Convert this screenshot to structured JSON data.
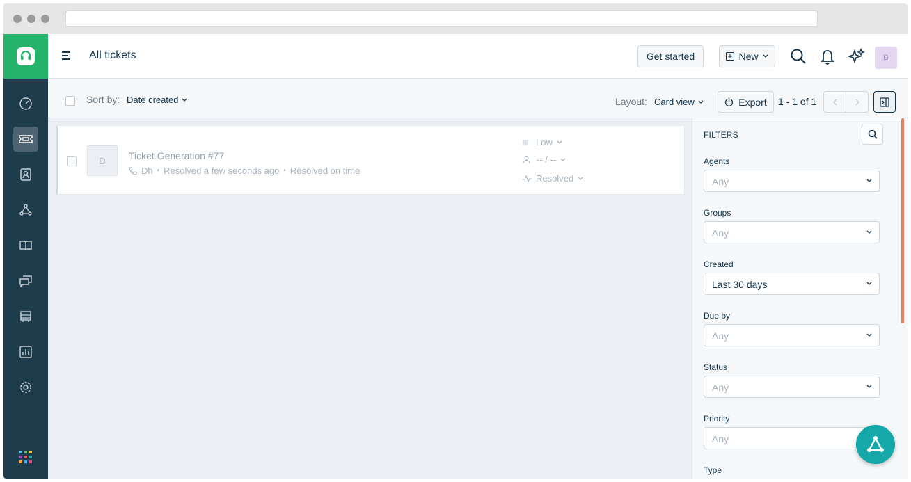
{
  "header": {
    "title": "All tickets",
    "get_started": "Get started",
    "new_label": "New",
    "avatar_initial": "D"
  },
  "toolbar": {
    "sort_label": "Sort by:",
    "sort_value": "Date created",
    "layout_label": "Layout:",
    "layout_value": "Card view",
    "export_label": "Export",
    "pagination": "1 - 1 of 1"
  },
  "ticket": {
    "avatar_initial": "D",
    "title": "Ticket Generation",
    "number": "#77",
    "requester": "Dh",
    "resolved_time": "Resolved a few seconds ago",
    "sla_status": "Resolved on time",
    "priority": "Low",
    "assignee": "-- / --",
    "status": "Resolved"
  },
  "filters": {
    "heading": "FILTERS",
    "items": [
      {
        "label": "Agents",
        "value": "Any"
      },
      {
        "label": "Groups",
        "value": "Any"
      },
      {
        "label": "Created",
        "value": "Last 30 days"
      },
      {
        "label": "Due by",
        "value": "Any"
      },
      {
        "label": "Status",
        "value": "Any"
      },
      {
        "label": "Priority",
        "value": "Any"
      },
      {
        "label": "Type",
        "value": ""
      }
    ]
  },
  "colors": {
    "sidebar": "#1f3c4c",
    "brand": "#25b36c",
    "fab": "#14a8a8",
    "scroll_accent": "#e67e58"
  },
  "icons": {
    "sidebar": [
      "dashboard-icon",
      "tickets-icon",
      "contacts-icon",
      "groups-icon",
      "solutions-icon",
      "forums-icon",
      "analytics-bench-icon",
      "reports-icon",
      "settings-icon",
      "apps-grid-icon"
    ]
  }
}
